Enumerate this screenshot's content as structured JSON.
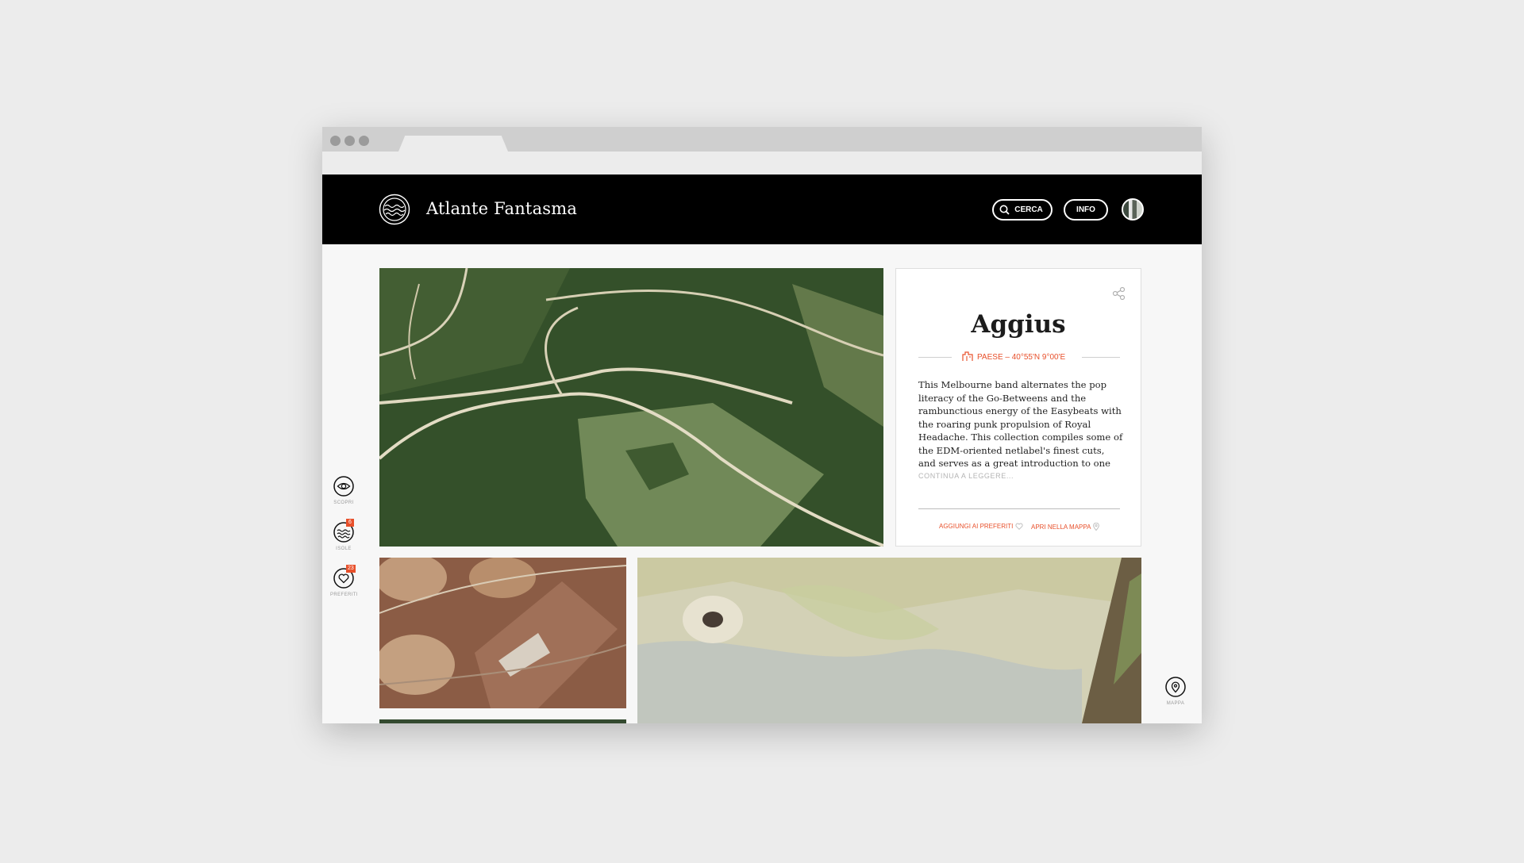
{
  "site": {
    "title": "Atlante Fantasma",
    "logo_icon": "waves-circle-logo"
  },
  "header": {
    "search_label": "CERCA",
    "info_label": "INFO",
    "avatar_icon": "user-avatar"
  },
  "card": {
    "title": "Aggius",
    "meta": "PAESE – 40°55'N 9°00'E",
    "meta_icon": "town-icon",
    "body": "This Melbourne band alternates the pop literacy of the Go-Betweens and the rambunctious energy of the Easybeats with the roaring punk propulsion of Royal Headache. This collection compiles some of the EDM-oriented netlabel's finest cuts, and serves as a great introduction to one",
    "read_more": "CONTINUA A LEGGERE...",
    "fav_label": "AGGIUNGI AI PREFERITI",
    "map_label": "APRI NELLA MAPPA",
    "accent_color": "#e8502b"
  },
  "sidenav": {
    "items": [
      {
        "label": "SCOPRI",
        "icon": "eye-icon",
        "badge": ""
      },
      {
        "label": "ISOLE",
        "icon": "waves-icon",
        "badge": "6"
      },
      {
        "label": "PREFERITI",
        "icon": "heart-icon",
        "badge": "23"
      }
    ],
    "map": {
      "label": "MAPPA",
      "icon": "map-pin-icon"
    }
  }
}
